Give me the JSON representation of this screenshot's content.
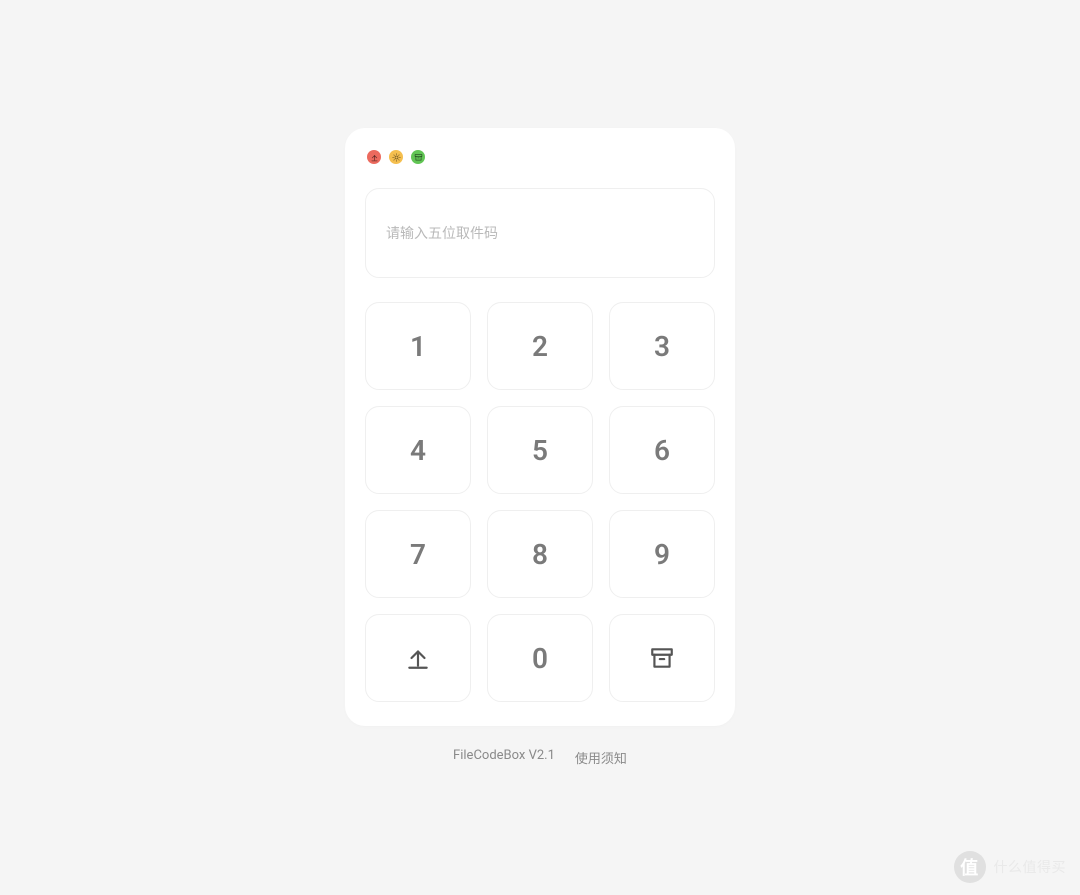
{
  "input": {
    "placeholder": "请输入五位取件码",
    "value": ""
  },
  "keypad": {
    "keys": [
      "1",
      "2",
      "3",
      "4",
      "5",
      "6",
      "7",
      "8",
      "9"
    ],
    "zero": "0"
  },
  "footer": {
    "app": "FileCodeBox V2.1",
    "terms": "使用须知"
  },
  "watermark": {
    "badge": "值",
    "text": "什么值得买"
  }
}
